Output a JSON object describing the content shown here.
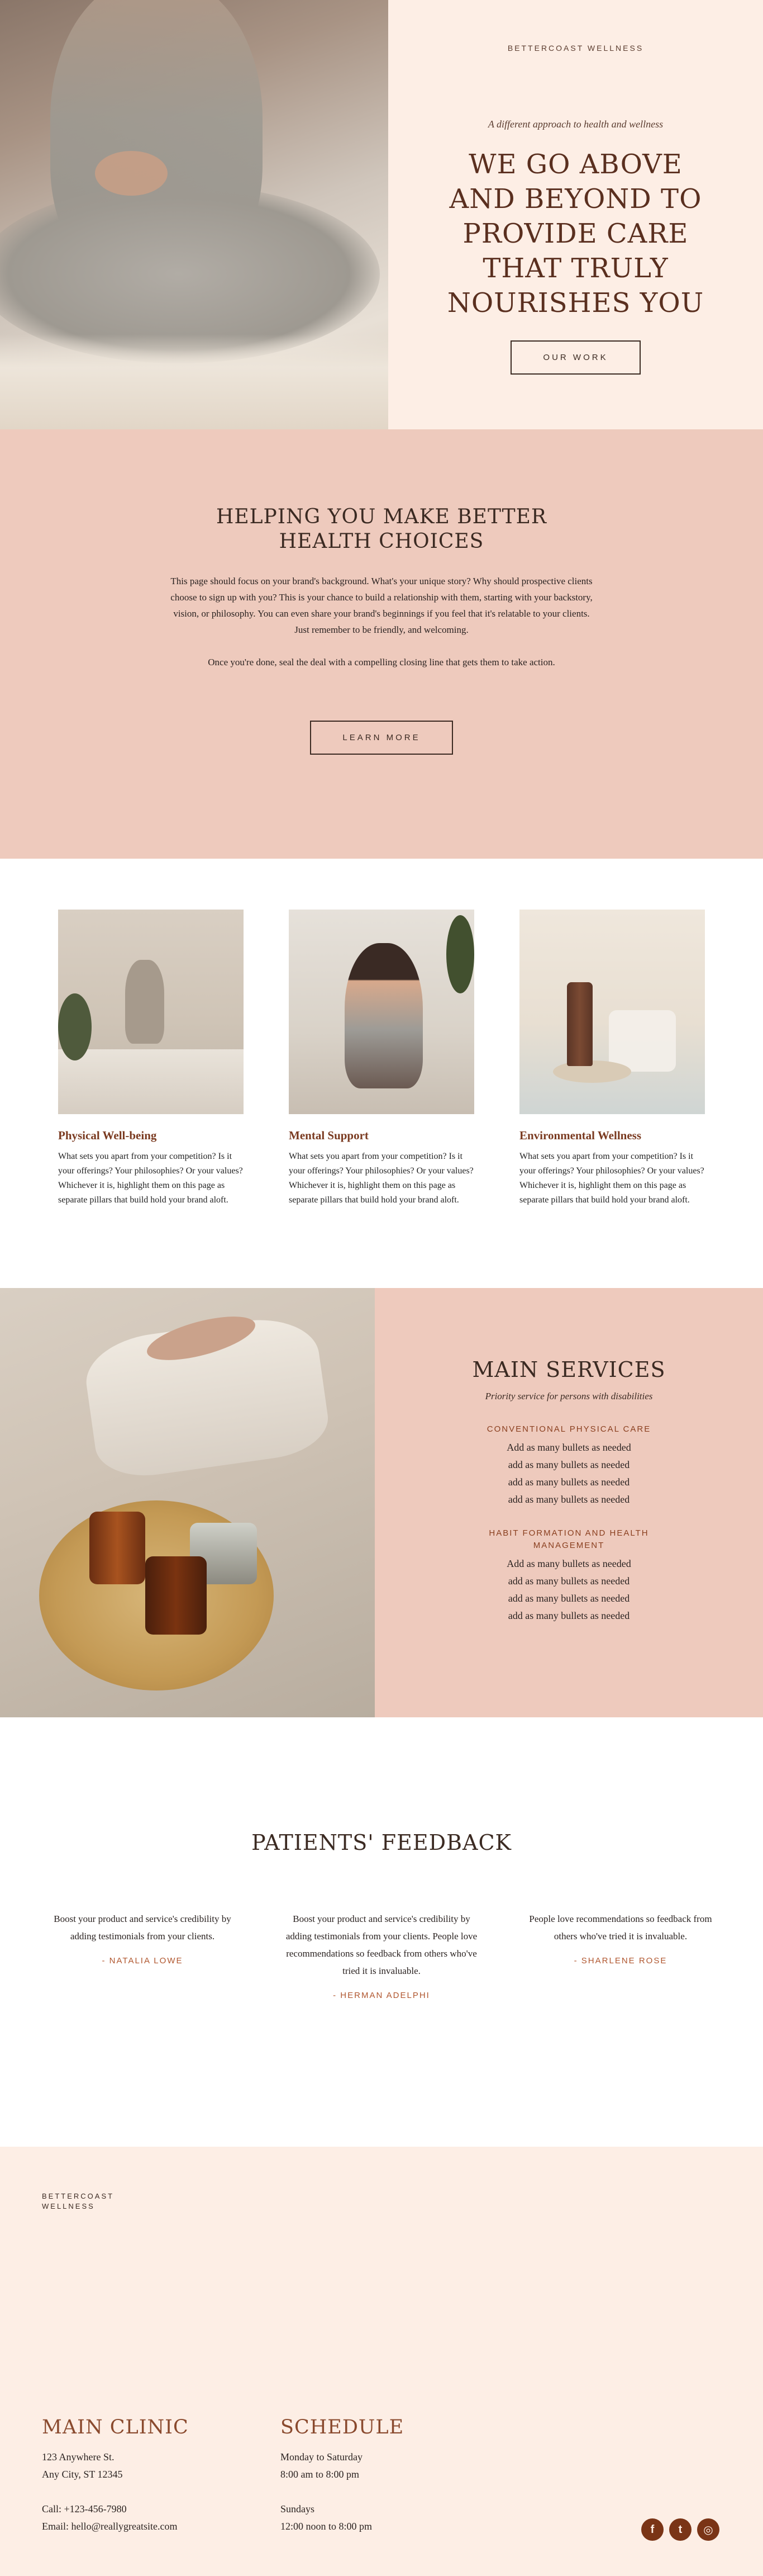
{
  "hero": {
    "brand": "BETTERCOAST WELLNESS",
    "tagline": "A different approach to health and wellness",
    "heading_lines": [
      "WE GO ABOVE",
      "AND BEYOND TO",
      "PROVIDE CARE",
      "THAT TRULY",
      "NOURISHES YOU"
    ],
    "button": "OUR WORK"
  },
  "about": {
    "heading_lines": [
      "HELPING YOU MAKE BETTER",
      "HEALTH CHOICES"
    ],
    "body": "This page should focus on your brand's background. What's your unique story? Why should prospective clients choose to sign up with you? This is your chance to build a relationship with them, starting with your backstory, vision, or philosophy. You can even share your brand's beginnings if you feel that it's relatable to your clients. Just remember to be friendly, and welcoming.",
    "closing": "Once you're done, seal the deal with a compelling closing line that gets them to take action.",
    "button": "LEARN MORE"
  },
  "pillars": [
    {
      "title": "Physical Well-being",
      "body": "What sets you apart from your competition? Is it your offerings? Your philosophies? Or your values? Whichever it is, highlight them on this page as separate pillars that build hold your brand aloft."
    },
    {
      "title": "Mental Support",
      "body": "What sets you apart from your competition? Is it your offerings? Your philosophies? Or your values? Whichever it is, highlight them on this page as separate pillars that build hold your brand aloft."
    },
    {
      "title": "Environmental Wellness",
      "body": "What sets you apart from your competition? Is it your offerings? Your philosophies? Or your values? Whichever it is, highlight them on this page as separate pillars that build hold your brand aloft."
    }
  ],
  "services": {
    "heading": "MAIN SERVICES",
    "subtitle": "Priority service for persons with disabilities",
    "categories": [
      {
        "title": "CONVENTIONAL PHYSICAL CARE",
        "items": [
          "Add as many bullets as needed",
          "add as many bullets as needed",
          "add as many bullets as needed",
          "add as many bullets as needed"
        ]
      },
      {
        "title": "HABIT FORMATION AND HEALTH MANAGEMENT",
        "items": [
          "Add as many bullets as needed",
          "add as many bullets as needed",
          "add as many bullets as needed",
          "add as many bullets as needed"
        ]
      }
    ]
  },
  "feedback": {
    "heading": "PATIENTS' FEEDBACK",
    "items": [
      {
        "quote": "Boost your product and service's credibility by adding testimonials from your clients.",
        "author": "- NATALIA LOWE"
      },
      {
        "quote": "Boost your product and service's credibility by adding testimonials from your clients. People love recommendations so feedback from others who've tried it is invaluable.",
        "author": "- HERMAN ADELPHI"
      },
      {
        "quote": "People love recommendations so feedback from others who've tried it is invaluable.",
        "author": "- SHARLENE ROSE"
      }
    ]
  },
  "footer": {
    "brand_lines": [
      "BETTERCOAST",
      "WELLNESS"
    ],
    "clinic": {
      "title": "MAIN CLINIC",
      "address_lines": [
        "123 Anywhere St.",
        "Any City, ST 12345"
      ],
      "contact_lines": [
        "Call: +123-456-7980",
        "Email: hello@reallygreatsite.com"
      ]
    },
    "schedule": {
      "title": "SCHEDULE",
      "weekday_lines": [
        "Monday to Saturday",
        "8:00 am to 8:00 pm"
      ],
      "sunday_lines": [
        "Sundays",
        "12:00 noon to 8:00 pm"
      ]
    },
    "socials": [
      {
        "name": "facebook-icon",
        "glyph": "f"
      },
      {
        "name": "twitter-icon",
        "glyph": "t"
      },
      {
        "name": "instagram-icon",
        "glyph": "◎"
      }
    ]
  },
  "colors": {
    "cream": "#fdeee5",
    "blush": "#eecabd",
    "rust": "#7a3a20",
    "dark": "#3b2a22"
  }
}
